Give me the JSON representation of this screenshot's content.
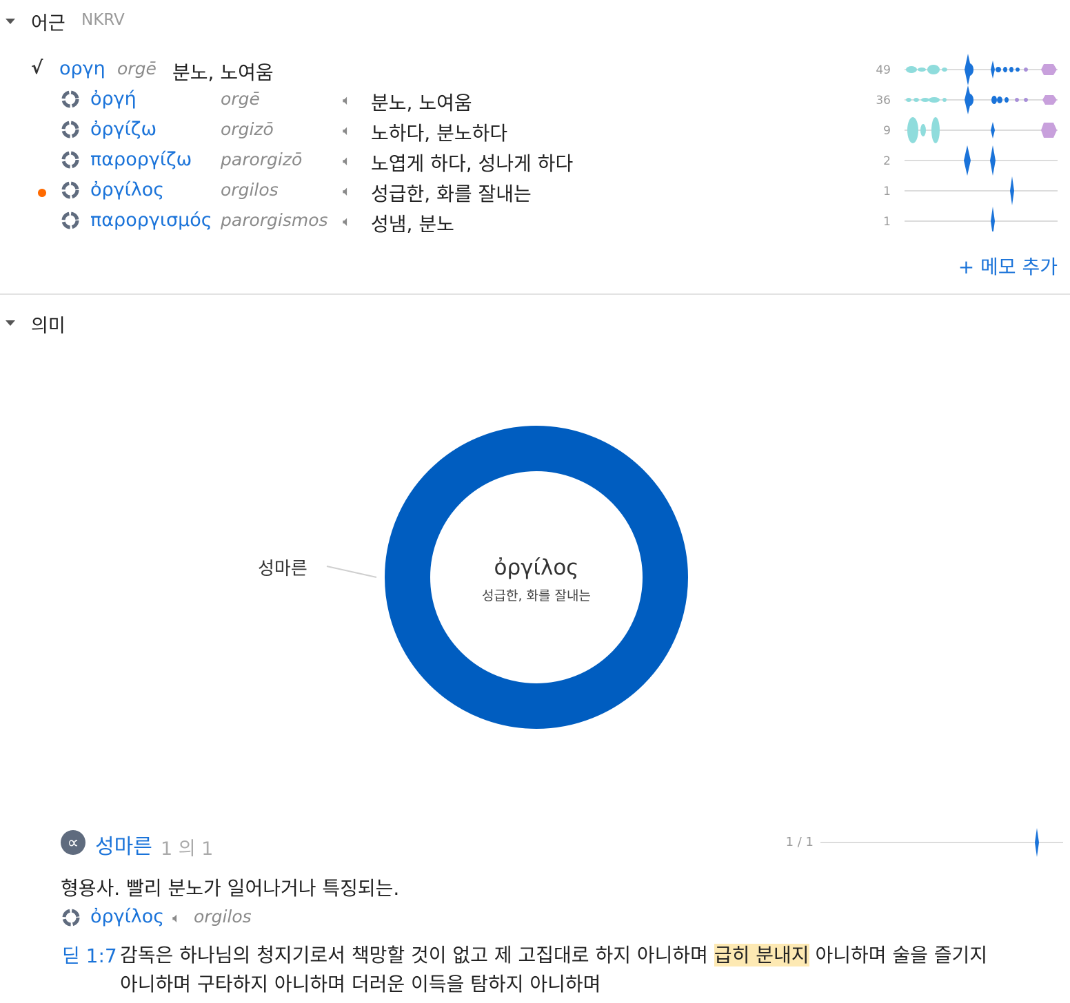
{
  "root_section": {
    "title": "어근",
    "version": "NKRV",
    "root": {
      "lemma": "οργη",
      "translit": "orgē",
      "gloss": "분노, 노여움",
      "count": "49"
    },
    "words": [
      {
        "lemma": "ὀργή",
        "translit": "orgē",
        "gloss": "분노, 노여움",
        "count": "36"
      },
      {
        "lemma": "ὀργίζω",
        "translit": "orgizō",
        "gloss": "노하다, 분노하다",
        "count": "9"
      },
      {
        "lemma": "παροργίζω",
        "translit": "parorgizō",
        "gloss": "노엽게 하다, 성나게 하다",
        "count": "2"
      },
      {
        "lemma": "ὀργίλος",
        "translit": "orgilos",
        "gloss": "성급한, 화를 잘내는",
        "count": "1"
      },
      {
        "lemma": "παροργισμός",
        "translit": "parorgismos",
        "gloss": "성냄, 분노",
        "count": "1"
      }
    ],
    "add_note": "+ 메모 추가"
  },
  "meaning_section": {
    "title": "의미",
    "donut": {
      "slice_label": "성마른",
      "center_title": "ὀργίλος",
      "center_sub": "성급한, 화를 잘내는",
      "color": "#005dc0",
      "share": 1.0
    },
    "sense": {
      "title": "성마른",
      "counter": "1 의 1",
      "fraction": "1 / 1",
      "definition": "형용사. 빨리 분노가 일어나거나 특징되는.",
      "word": {
        "lemma": "ὀργίλος",
        "translit": "orgilos"
      },
      "verse": {
        "ref": "딛 1:7",
        "line1_pre": "감독은 하나님의 청지기로서 책망할 것이 없고 제 고집대로 하지 아니하며",
        "line1_hl": "급히 분내지",
        "line1_post": "아니하며 술을 즐기지",
        "line2": "아니하며 구타하지 아니하며 더러운 이득을 탐하지 아니하며"
      }
    }
  },
  "colors": {
    "accent": "#1a73d9",
    "donut": "#005dc0",
    "teal": "#8fdcdc",
    "purple": "#c8a0dc",
    "dot": "#ff6a00"
  }
}
